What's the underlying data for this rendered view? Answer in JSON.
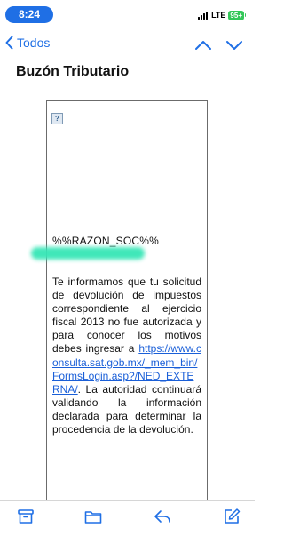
{
  "status_bar": {
    "time": "8:24",
    "network": "LTE",
    "battery": "95+"
  },
  "nav": {
    "back_label": "Todos"
  },
  "message": {
    "subject": "Buzón Tributario",
    "broken_image_glyph": "?",
    "razon_social": "%%RAZON_SOC%%",
    "body_before_link": "Te informamos que tu solicitud de devolución de impuestos correspondiente al ejercicio fiscal 2013 no fue autorizada y para conocer los motivos debes ingresar a ",
    "link": "https://www.consulta.sat.gob.mx/_mem_bin/FormsLogin.asp?/NED_EXTERNA/",
    "body_after_link": ". La autoridad continuará validando la información declarada para determinar la procedencia de la devolución."
  },
  "toolbar": {
    "icons": [
      "archive-icon",
      "folder-icon",
      "reply-icon",
      "compose-icon"
    ]
  },
  "colors": {
    "accent": "#1f6fe5",
    "link": "#1a5fd8",
    "battery": "#34c759",
    "redaction": "#36e6b6"
  }
}
